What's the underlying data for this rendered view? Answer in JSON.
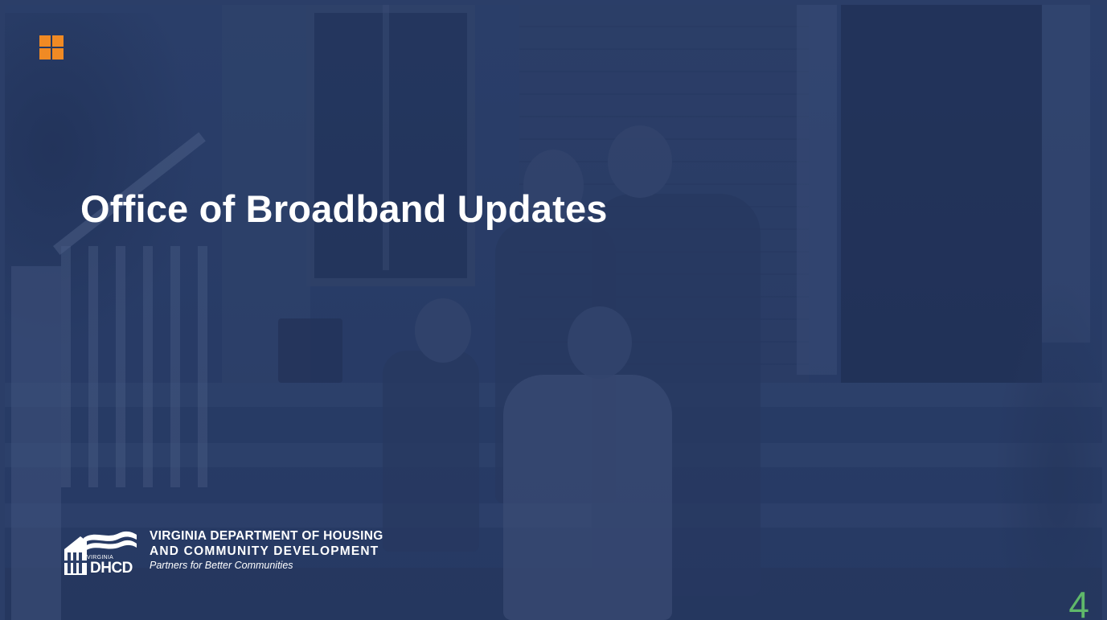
{
  "slide": {
    "title": "Office of Broadband Updates",
    "page_number": "4"
  },
  "logo": {
    "line1": "VIRGINIA DEPARTMENT OF HOUSING",
    "line2": "AND COMMUNITY DEVELOPMENT",
    "tagline": "Partners for Better Communities",
    "mark_small_text": "VIRGINIA",
    "mark_text": "DHCD"
  },
  "icons": {
    "grid": "grid-icon"
  },
  "colors": {
    "background": "#2b3e68",
    "grid_icon": "#f08a24",
    "title": "#ffffff",
    "page_number": "#5fb86a"
  }
}
